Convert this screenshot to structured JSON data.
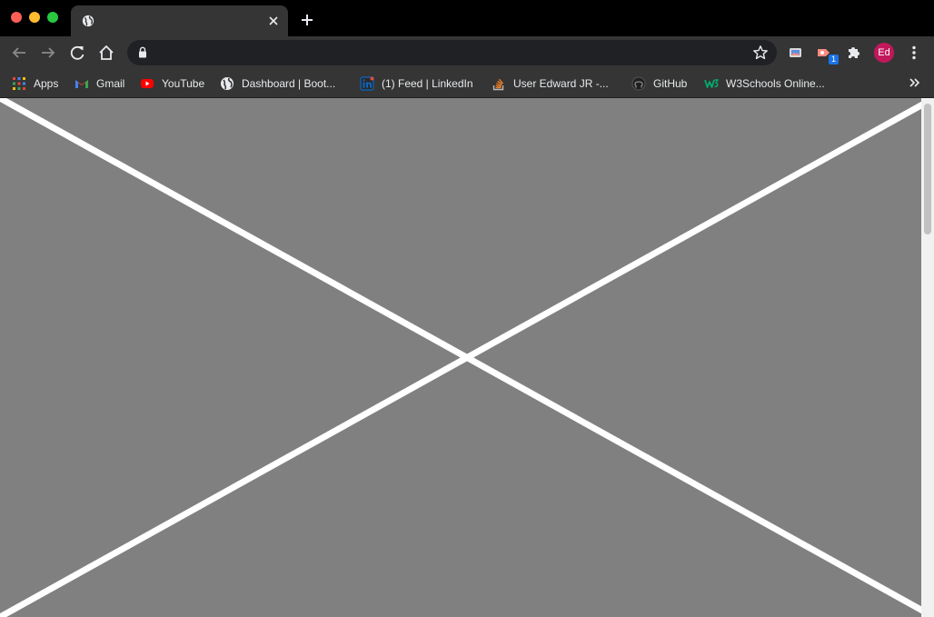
{
  "tab": {
    "title": ""
  },
  "omnibox": {
    "url": ""
  },
  "profile": {
    "initials": "Ed"
  },
  "extension_badge": "1",
  "bookmarks": [
    {
      "label": "Apps",
      "icon": "apps-grid-icon"
    },
    {
      "label": "Gmail",
      "icon": "gmail-icon"
    },
    {
      "label": "YouTube",
      "icon": "youtube-icon"
    },
    {
      "label": "Dashboard | Boot...",
      "icon": "globe-icon"
    },
    {
      "label": "(1) Feed | LinkedIn",
      "icon": "linkedin-icon"
    },
    {
      "label": "User Edward JR -...",
      "icon": "stackoverflow-icon"
    },
    {
      "label": "GitHub",
      "icon": "github-icon"
    },
    {
      "label": "W3Schools Online...",
      "icon": "w3schools-icon"
    }
  ],
  "colors": {
    "chrome_dark": "#353535",
    "content_bg": "#808080",
    "cross_stroke": "#ffffff",
    "avatar": "#c2185b"
  }
}
